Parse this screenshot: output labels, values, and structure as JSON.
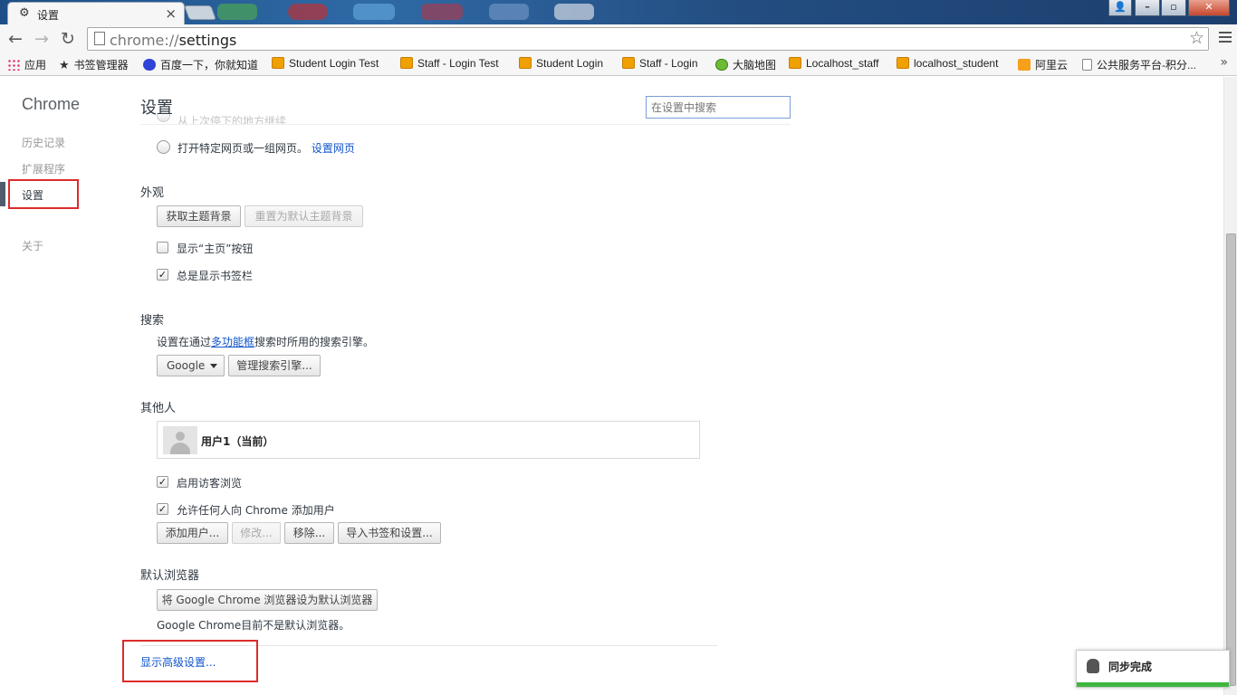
{
  "window": {
    "tab_title": "设置",
    "tab_close": "×",
    "url_scheme": "chrome://",
    "url_path": "settings"
  },
  "bookmarks": [
    {
      "label": "应用",
      "icon": "apps-icon"
    },
    {
      "label": "书签管理器",
      "icon": "star-icon"
    },
    {
      "label": "百度一下，你就知道",
      "icon": "baidu-icon"
    },
    {
      "label": "Student Login Test",
      "icon": "site-icon"
    },
    {
      "label": "Staff - Login Test",
      "icon": "site-icon"
    },
    {
      "label": "Student Login",
      "icon": "site-icon"
    },
    {
      "label": "Staff - Login",
      "icon": "site-icon"
    },
    {
      "label": "大脑地图",
      "icon": "brain-icon"
    },
    {
      "label": "Localhost_staff",
      "icon": "site-icon"
    },
    {
      "label": "localhost_student",
      "icon": "site-icon"
    },
    {
      "label": "阿里云",
      "icon": "aliyun-icon"
    },
    {
      "label": "公共服务平台-积分...",
      "icon": "document-icon"
    }
  ],
  "nav": {
    "logo": "Chrome",
    "history": "历史记录",
    "extensions": "扩展程序",
    "settings": "设置",
    "about": "关于"
  },
  "header": {
    "title": "设置",
    "search_placeholder": "在设置中搜索",
    "faded_text": "从上次停下的地方继续"
  },
  "startup": {
    "open_specific": "打开特定网页或一组网页。",
    "set_pages_link": "设置网页"
  },
  "appearance": {
    "title": "外观",
    "get_themes": "获取主题背景",
    "reset_theme": "重置为默认主题背景",
    "show_home_button": "显示“主页”按钮",
    "show_home_button_checked": false,
    "always_show_bookmarks": "总是显示书签栏",
    "always_show_bookmarks_checked": true
  },
  "search": {
    "title": "搜索",
    "desc_prefix": "设置在通过",
    "desc_link": "多功能框",
    "desc_suffix": "搜索时所用的搜索引擎。",
    "engine": "Google",
    "manage": "管理搜索引擎..."
  },
  "people": {
    "title": "其他人",
    "current_user": "用户1（当前）",
    "guest_browsing": "启用访客浏览",
    "allow_add_users": "允许任何人向 Chrome 添加用户",
    "add_user": "添加用户...",
    "edit": "修改...",
    "remove": "移除...",
    "import": "导入书签和设置..."
  },
  "default_browser": {
    "title": "默认浏览器",
    "make_default": "将 Google Chrome 浏览器设为默认浏览器",
    "status": "Google Chrome目前不是默认浏览器。"
  },
  "advanced_link": "显示高级设置...",
  "sync": {
    "text": "同步完成"
  },
  "colors": {
    "link": "#1155cc",
    "highlight": "#dd2b2b",
    "sync_bar": "#3fb640"
  }
}
